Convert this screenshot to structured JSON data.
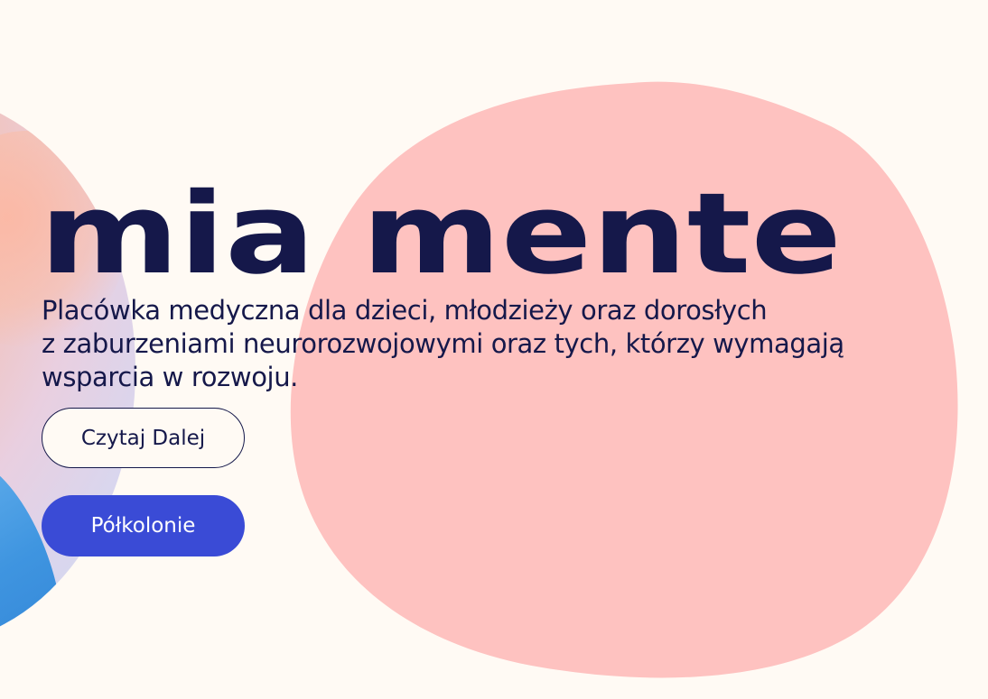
{
  "hero": {
    "logo_text": "mia mente",
    "tagline_lines": [
      "Placówka medyczna dla dzieci, młodzieży oraz dorosłych",
      "z zaburzeniami neurorozwojowymi oraz tych, którzy wymagają",
      "wsparcia w rozwoju."
    ],
    "primary_button_label": "Czytaj Dalej",
    "secondary_button_label": "Półkolonie"
  },
  "colors": {
    "background": "#fffaf4",
    "blob": "#fec2c0",
    "text": "#15184a",
    "accent_button": "#3a4bd6"
  }
}
